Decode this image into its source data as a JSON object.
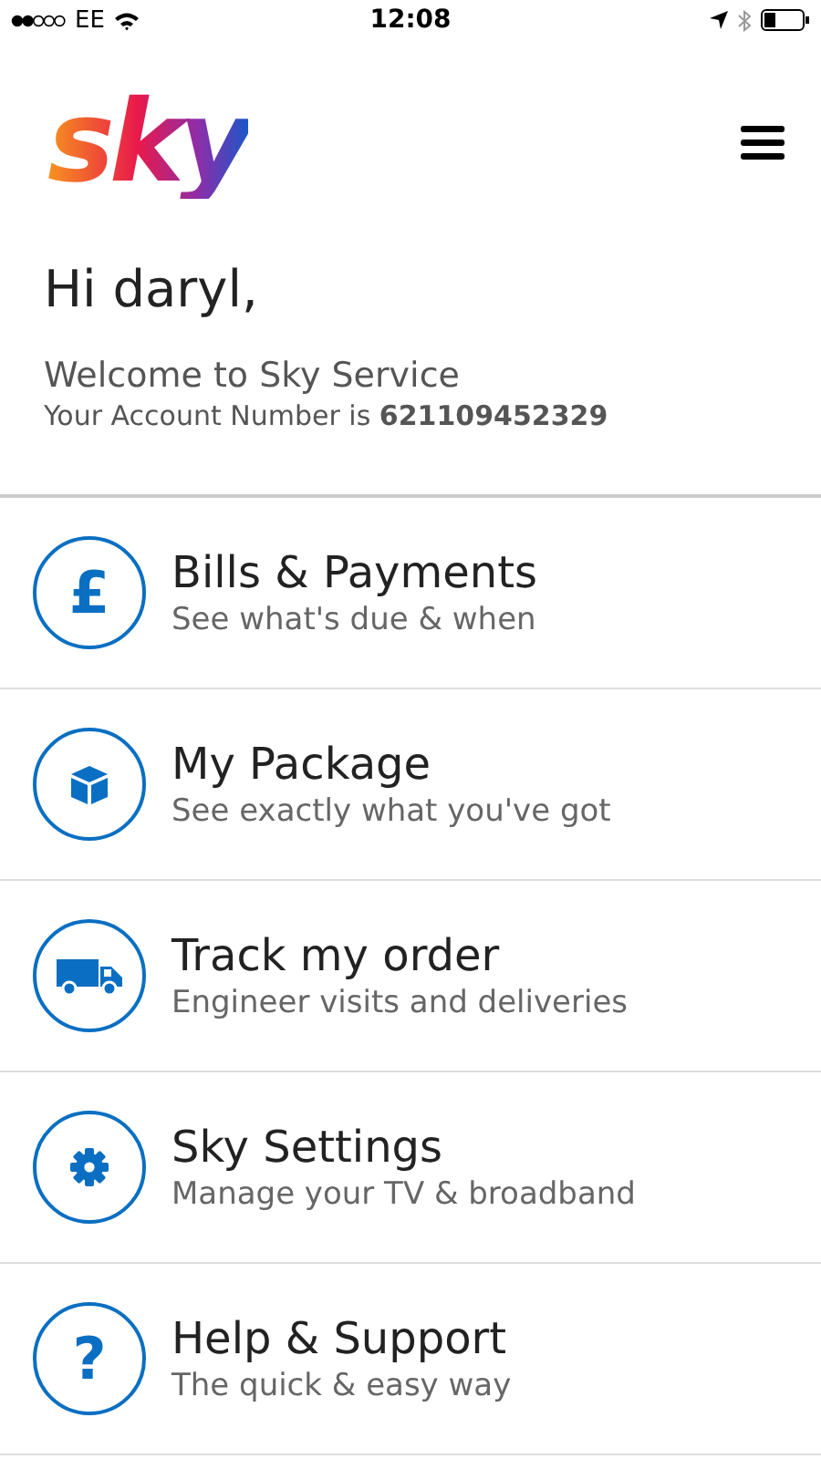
{
  "status_bar": {
    "carrier": "EE",
    "time": "12:08"
  },
  "header": {
    "logo": "sky"
  },
  "greeting": {
    "title": "Hi daryl,",
    "welcome": "Welcome to Sky Service",
    "account": "Your Account Number is **621109452329**"
  },
  "menu": [
    {
      "icon": {
        "kind": "glyph",
        "text": "£"
      },
      "title": "Bills & Payments",
      "subtitle": "See what's due & when"
    },
    {
      "icon": {
        "kind": "box"
      },
      "title": "My Package",
      "subtitle": "See exactly what you've got"
    },
    {
      "icon": {
        "kind": "van"
      },
      "title": "Track my order",
      "subtitle": "Engineer visits and deliveries"
    },
    {
      "icon": {
        "kind": "gear"
      },
      "title": "Sky Settings",
      "subtitle": "Manage your TV & broadband"
    },
    {
      "icon": {
        "kind": "glyph",
        "text": "?"
      },
      "title": "Help & Support",
      "subtitle": "The quick & easy way"
    }
  ]
}
